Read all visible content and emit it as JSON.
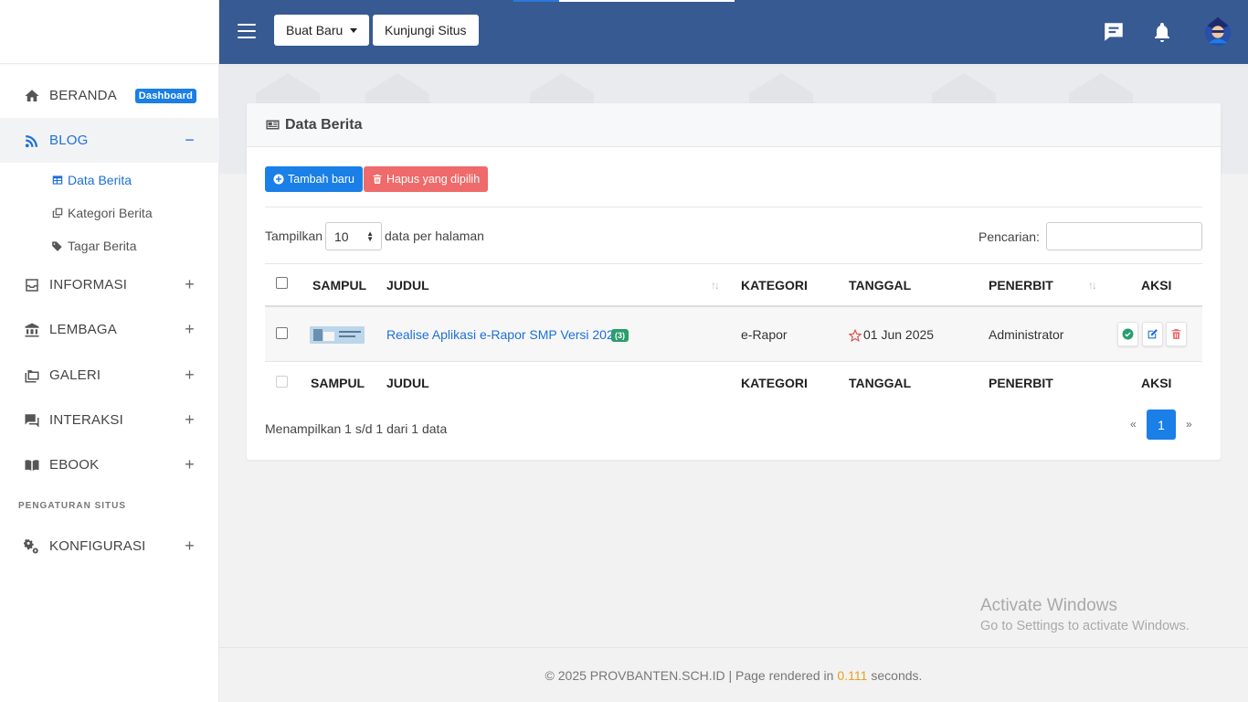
{
  "sidebar": {
    "items": [
      {
        "label": "BERANDA",
        "badge": "Dashboard",
        "icon": "home-icon"
      },
      {
        "label": "BLOG",
        "toggle": "−",
        "icon": "rss-icon"
      },
      {
        "label": "INFORMASI",
        "toggle": "+",
        "icon": "inbox-icon"
      },
      {
        "label": "LEMBAGA",
        "toggle": "+",
        "icon": "bank-icon"
      },
      {
        "label": "GALERI",
        "toggle": "+",
        "icon": "folders-icon"
      },
      {
        "label": "INTERAKSI",
        "toggle": "+",
        "icon": "chat-icon"
      },
      {
        "label": "EBOOK",
        "toggle": "+",
        "icon": "book-icon"
      },
      {
        "label": "KONFIGURASI",
        "toggle": "+",
        "icon": "gears-icon"
      }
    ],
    "blog_sub": [
      {
        "label": "Data Berita",
        "icon": "table-icon"
      },
      {
        "label": "Kategori Berita",
        "icon": "clone-icon"
      },
      {
        "label": "Tagar Berita",
        "icon": "tags-icon"
      }
    ],
    "heading": "PENGATURAN SITUS"
  },
  "topbar": {
    "new_button": "Buat Baru",
    "visit_button": "Kunjungi Situs"
  },
  "card": {
    "title": "Data Berita",
    "add_button": "Tambah baru",
    "delete_button": "Hapus yang dipilih",
    "show_label": "Tampilkan",
    "per_page": "10",
    "per_page_suffix": "data per halaman",
    "search_label": "Pencarian:",
    "search_value": ""
  },
  "table": {
    "columns": [
      "SAMPUL",
      "JUDUL",
      "KATEGORI",
      "TANGGAL",
      "PENERBIT",
      "AKSI"
    ],
    "rows": [
      {
        "title": "Realise Aplikasi e-Rapor SMP Versi 2025",
        "count": "(3)",
        "category": "e-Rapor",
        "date": "01 Jun 2025",
        "publisher": "Administrator"
      }
    ]
  },
  "pagination": {
    "info": "Menampilkan 1 s/d 1 dari 1 data",
    "prev": "«",
    "current": "1",
    "next": "»"
  },
  "watermark": {
    "line1": "Activate Windows",
    "line2": "Go to Settings to activate Windows."
  },
  "footer": {
    "prefix": "© 2025 PROVBANTEN.SCH.ID | Page rendered in",
    "time": "0.111",
    "suffix": "seconds."
  },
  "colors": {
    "topbar": "#365a91",
    "accent": "#1a7fe6",
    "danger": "#ef6a6a",
    "success": "#2a9d6e"
  }
}
